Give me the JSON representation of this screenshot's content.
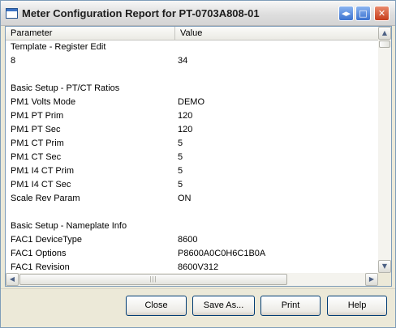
{
  "window": {
    "title": "Meter Configuration Report for PT-0703A808-01"
  },
  "columns": {
    "parameter": "Parameter",
    "value": "Value"
  },
  "rows": [
    {
      "param": "Template - Register Edit",
      "value": ""
    },
    {
      "param": "8",
      "value": "34"
    },
    {
      "param": "",
      "value": ""
    },
    {
      "param": "Basic Setup - PT/CT Ratios",
      "value": ""
    },
    {
      "param": "PM1 Volts Mode",
      "value": "DEMO"
    },
    {
      "param": "PM1 PT Prim",
      "value": "120"
    },
    {
      "param": "PM1 PT Sec",
      "value": "120"
    },
    {
      "param": "PM1 CT Prim",
      "value": "5"
    },
    {
      "param": "PM1 CT Sec",
      "value": "5"
    },
    {
      "param": "PM1 I4 CT Prim",
      "value": "5"
    },
    {
      "param": "PM1 I4 CT Sec",
      "value": "5"
    },
    {
      "param": "Scale Rev Param",
      "value": "ON"
    },
    {
      "param": "",
      "value": ""
    },
    {
      "param": "Basic Setup - Nameplate Info",
      "value": ""
    },
    {
      "param": "FAC1 DeviceType",
      "value": "8600"
    },
    {
      "param": "FAC1 Options",
      "value": "P8600A0C0H6C1B0A"
    },
    {
      "param": "FAC1 Revision",
      "value": "8600V312"
    }
  ],
  "buttons": {
    "close": "Close",
    "save_as": "Save As...",
    "print": "Print",
    "help": "Help"
  },
  "icons": {
    "help": "help-icon",
    "maximize": "maximize-icon",
    "close": "close-icon",
    "scroll_up": "scroll-up-arrow-icon",
    "scroll_down": "scroll-down-arrow-icon",
    "scroll_left": "scroll-left-arrow-icon",
    "scroll_right": "scroll-right-arrow-icon"
  }
}
